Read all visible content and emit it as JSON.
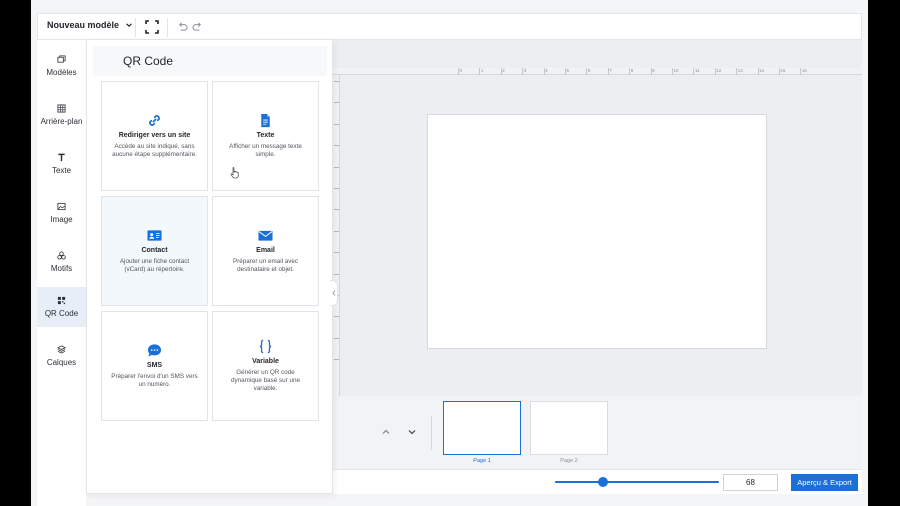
{
  "topbar": {
    "model_label": "Nouveau modèle"
  },
  "rail": {
    "items": [
      {
        "label": "Modèles",
        "icon": "templates-icon"
      },
      {
        "label": "Arrière-plan",
        "icon": "background-icon"
      },
      {
        "label": "Texte",
        "icon": "text-icon"
      },
      {
        "label": "Image",
        "icon": "image-icon"
      },
      {
        "label": "Motifs",
        "icon": "shapes-icon"
      },
      {
        "label": "QR Code",
        "icon": "qr-code-icon",
        "active": true
      },
      {
        "label": "Calques",
        "icon": "layers-icon"
      }
    ]
  },
  "panel": {
    "title": "QR Code",
    "cards": [
      {
        "title": "Rediriger vers un site",
        "desc": "Accède au site indiqué, sans aucune étape supplémentaire.",
        "icon": "link-icon"
      },
      {
        "title": "Texte",
        "desc": "Afficher un message texte simple.",
        "icon": "document-icon"
      },
      {
        "title": "Contact",
        "desc": "Ajouter une fiche contact (vCard) au répertoire.",
        "icon": "contact-card-icon"
      },
      {
        "title": "Email",
        "desc": "Préparer un email avec destinataire et objet.",
        "icon": "envelope-icon"
      },
      {
        "title": "SMS",
        "desc": "Préparer l'envoi d'un SMS vers un numéro.",
        "icon": "chat-bubble-icon"
      },
      {
        "title": "Variable",
        "desc": "Générer un QR code dynamique basé sur une variable.",
        "icon": "curly-braces-icon"
      }
    ]
  },
  "ruler": {
    "labels": [
      "0",
      "1",
      "2",
      "3",
      "4",
      "5",
      "6",
      "7",
      "8",
      "9",
      "10",
      "11",
      "12",
      "13",
      "14",
      "15",
      "16"
    ]
  },
  "pages": {
    "items": [
      {
        "label": "Page 1",
        "active": true
      },
      {
        "label": "Page 2",
        "active": false
      }
    ]
  },
  "bottombar": {
    "zoom_value": "68",
    "zoom_fraction": 0.29,
    "export_label": "Aperçu & Export"
  },
  "colors": {
    "accent": "#1a6fd9",
    "active_rail_bg": "#e7eef8"
  }
}
